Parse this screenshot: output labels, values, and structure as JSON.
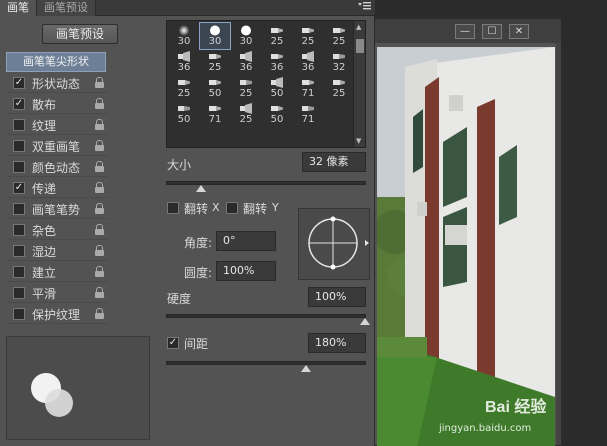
{
  "tabs": [
    {
      "label": "画笔"
    },
    {
      "label": "画笔预设"
    }
  ],
  "panel_menu_icon": "menu-icon",
  "preset_button": "画笔预设",
  "options": {
    "header": "画笔笔尖形状",
    "items": [
      {
        "label": "形状动态",
        "checked": true,
        "checkmark": "✓"
      },
      {
        "label": "散布",
        "checked": true,
        "checkmark": "✓"
      },
      {
        "label": "纹理",
        "checked": false,
        "checkmark": ""
      },
      {
        "label": "双重画笔",
        "checked": false,
        "checkmark": ""
      },
      {
        "label": "颜色动态",
        "checked": false,
        "checkmark": ""
      },
      {
        "label": "传递",
        "checked": true,
        "checkmark": "✓"
      },
      {
        "label": "画笔笔势",
        "checked": false,
        "checkmark": ""
      },
      {
        "label": "杂色",
        "checked": false,
        "checkmark": ""
      },
      {
        "label": "湿边",
        "checked": false,
        "checkmark": ""
      },
      {
        "label": "建立",
        "checked": false,
        "checkmark": ""
      },
      {
        "label": "平滑",
        "checked": false,
        "checkmark": ""
      },
      {
        "label": "保护纹理",
        "checked": false,
        "checkmark": ""
      }
    ]
  },
  "tips": [
    "30",
    "30",
    "30",
    "25",
    "25",
    "25",
    "36",
    "25",
    "36",
    "36",
    "36",
    "32",
    "25",
    "50",
    "25",
    "50",
    "71",
    "25",
    "50",
    "71",
    "25",
    "50",
    "71"
  ],
  "size": {
    "label": "大小",
    "value": "32 像素",
    "slider_fraction": 0.17
  },
  "flip": {
    "label": "翻转",
    "x": "X",
    "y": "Y"
  },
  "angle": {
    "label": "角度:",
    "value": "0°"
  },
  "roundness": {
    "label": "圆度:",
    "value": "100%"
  },
  "hardness": {
    "label": "硬度",
    "value": "100%",
    "slider_fraction": 1.0
  },
  "spacing": {
    "label": "间距",
    "value": "180%",
    "checkmark": "✓",
    "slider_fraction": 0.7
  },
  "document_window": {
    "minimize": "—",
    "maximize": "☐",
    "close": "✕"
  },
  "watermark": {
    "brand": "Bai 经验",
    "url": "jingyan.baidu.com"
  },
  "colors": {
    "panel": "#535353",
    "selection": "#6c7f96",
    "dark": "#2b2b2b"
  }
}
